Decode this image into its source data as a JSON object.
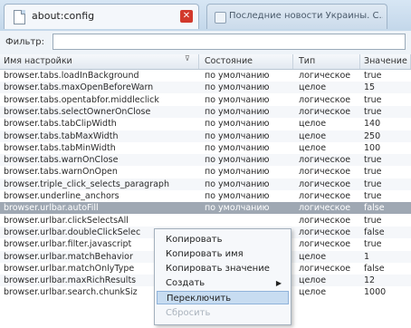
{
  "tabs": [
    {
      "title": "about:config",
      "close_label": "✕"
    },
    {
      "title": "Последние новости Украины. С..."
    }
  ],
  "filter": {
    "label": "Фильтр:",
    "value": ""
  },
  "columns": [
    "Имя настройки",
    "Состояние",
    "Тип",
    "Значение"
  ],
  "rows": [
    {
      "name": "browser.tabs.loadInBackground",
      "state": "по умолчанию",
      "type": "логическое",
      "value": "true"
    },
    {
      "name": "browser.tabs.maxOpenBeforeWarn",
      "state": "по умолчанию",
      "type": "целое",
      "value": "15"
    },
    {
      "name": "browser.tabs.opentabfor.middleclick",
      "state": "по умолчанию",
      "type": "логическое",
      "value": "true"
    },
    {
      "name": "browser.tabs.selectOwnerOnClose",
      "state": "по умолчанию",
      "type": "логическое",
      "value": "true"
    },
    {
      "name": "browser.tabs.tabClipWidth",
      "state": "по умолчанию",
      "type": "целое",
      "value": "140"
    },
    {
      "name": "browser.tabs.tabMaxWidth",
      "state": "по умолчанию",
      "type": "целое",
      "value": "250"
    },
    {
      "name": "browser.tabs.tabMinWidth",
      "state": "по умолчанию",
      "type": "целое",
      "value": "100"
    },
    {
      "name": "browser.tabs.warnOnClose",
      "state": "по умолчанию",
      "type": "логическое",
      "value": "true"
    },
    {
      "name": "browser.tabs.warnOnOpen",
      "state": "по умолчанию",
      "type": "логическое",
      "value": "true"
    },
    {
      "name": "browser.triple_click_selects_paragraph",
      "state": "по умолчанию",
      "type": "логическое",
      "value": "true"
    },
    {
      "name": "browser.underline_anchors",
      "state": "по умолчанию",
      "type": "логическое",
      "value": "true"
    },
    {
      "name": "browser.urlbar.autoFill",
      "state": "по умолчанию",
      "type": "логическое",
      "value": "false"
    },
    {
      "name": "browser.urlbar.clickSelectsAll",
      "state": "",
      "type": "логическое",
      "value": "true"
    },
    {
      "name": "browser.urlbar.doubleClickSelec",
      "state": "",
      "type": "логическое",
      "value": "false"
    },
    {
      "name": "browser.urlbar.filter.javascript",
      "state": "",
      "type": "логическое",
      "value": "true"
    },
    {
      "name": "browser.urlbar.matchBehavior",
      "state": "",
      "type": "целое",
      "value": "1"
    },
    {
      "name": "browser.urlbar.matchOnlyType",
      "state": "",
      "type": "логическое",
      "value": "false"
    },
    {
      "name": "browser.urlbar.maxRichResults",
      "state": "",
      "type": "целое",
      "value": "12"
    },
    {
      "name": "browser.urlbar.search.chunkSiz",
      "state": "",
      "type": "целое",
      "value": "1000"
    }
  ],
  "context_menu": {
    "items": [
      "Копировать",
      "Копировать имя",
      "Копировать значение",
      "Создать",
      "Переключить",
      "Сбросить"
    ]
  },
  "colors": {
    "selected_row": "#9fa8b3",
    "menu_highlight": "#c7dcf1",
    "close_button": "#d2392c"
  }
}
